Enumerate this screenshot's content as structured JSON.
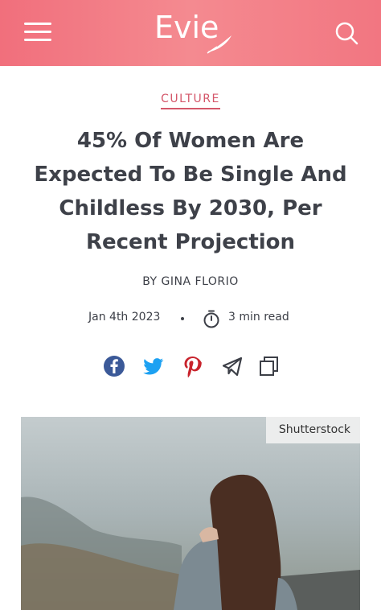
{
  "header": {
    "logo_text": "Evie",
    "icons": [
      "menu-icon",
      "search-icon"
    ],
    "background": "#f27c86"
  },
  "article": {
    "category": "CULTURE",
    "title": "45% Of Women Are Expected To Be Single And Childless By 2030, Per Recent Projection",
    "byline": "BY GINA FLORIO",
    "date": "Jan 4th 2023",
    "separator": "•",
    "read_time": "3 min read",
    "accent_color": "#d4576a"
  },
  "share": {
    "icons": [
      "facebook-icon",
      "twitter-icon",
      "pinterest-icon",
      "telegram-icon",
      "copy-icon"
    ],
    "colors": {
      "facebook": "#3b5998",
      "twitter": "#1da1f2",
      "pinterest": "#c8232c",
      "telegram": "#3c3f47",
      "copy": "#3c3f47"
    }
  },
  "image": {
    "credit": "Shutterstock",
    "icon": "hero-photo"
  }
}
